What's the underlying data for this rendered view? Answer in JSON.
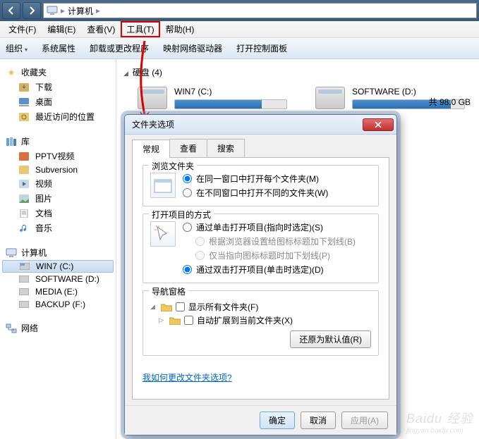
{
  "titlebar": {
    "address": "计算机"
  },
  "menubar": {
    "file": "文件(F)",
    "edit": "编辑(E)",
    "view": "查看(V)",
    "tools": "工具(T)",
    "help": "帮助(H)"
  },
  "toolbar": {
    "organize": "组织",
    "sysprops": "系统属性",
    "uninstall": "卸载或更改程序",
    "mapdrive": "映射网络驱动器",
    "ctrlpanel": "打开控制面板"
  },
  "sidebar": {
    "favorites": {
      "label": "收藏夹",
      "items": [
        "下载",
        "桌面",
        "最近访问的位置"
      ]
    },
    "libraries": {
      "label": "库",
      "items": [
        "PPTV视频",
        "Subversion",
        "视频",
        "图片",
        "文档",
        "音乐"
      ]
    },
    "computer": {
      "label": "计算机",
      "items": [
        "WIN7 (C:)",
        "SOFTWARE (D:)",
        "MEDIA (E:)",
        "BACKUP (F:)"
      ]
    },
    "network": {
      "label": "网络"
    }
  },
  "content": {
    "disks_header": "硬盘 (4)",
    "disk1": "WIN7 (C:)",
    "disk2": "SOFTWARE (D:)",
    "storage_note": "共 98.0 GB"
  },
  "dialog": {
    "title": "文件夹选项",
    "tabs": {
      "general": "常规",
      "view": "查看",
      "search": "搜索"
    },
    "browse": {
      "legend": "浏览文件夹",
      "opt1": "在同一窗口中打开每个文件夹(M)",
      "opt2": "在不同窗口中打开不同的文件夹(W)"
    },
    "click": {
      "legend": "打开项目的方式",
      "opt1": "通过单击打开项目(指向时选定)(S)",
      "opt1a": "根据浏览器设置给图标标题加下划线(B)",
      "opt1b": "仅当指向图标标题时加下划线(P)",
      "opt2": "通过双击打开项目(单击时选定)(D)"
    },
    "navpane": {
      "legend": "导航窗格",
      "opt1": "显示所有文件夹(F)",
      "opt2": "自动扩展到当前文件夹(X)"
    },
    "restore": "还原为默认值(R)",
    "help_link": "我如何更改文件夹选项?",
    "ok": "确定",
    "cancel": "取消",
    "apply": "应用(A)"
  },
  "watermark": {
    "brand": "Baidu 经验",
    "url": "jingyan.baidu.com"
  }
}
